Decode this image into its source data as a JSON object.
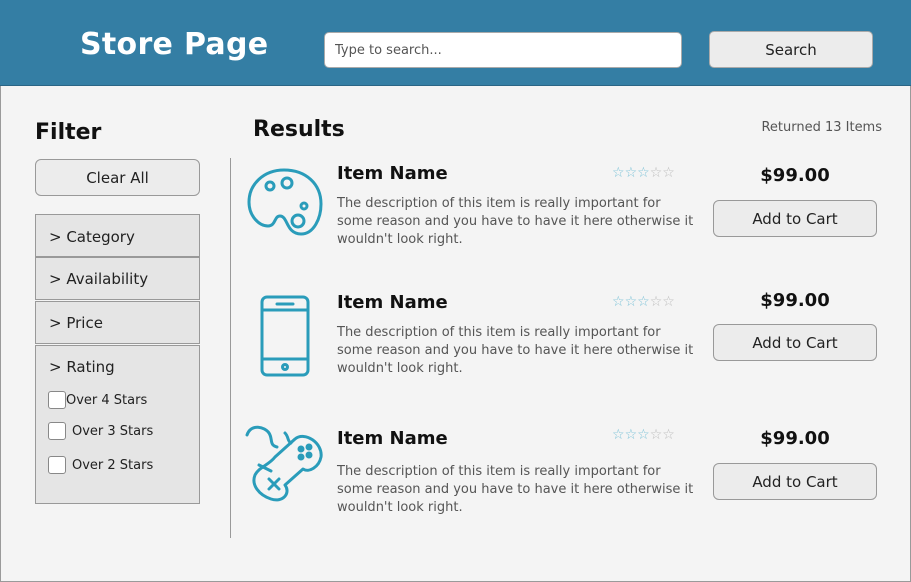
{
  "header": {
    "title": "Store Page",
    "search_placeholder": "Type to search...",
    "search_label": "Search"
  },
  "filter": {
    "title": "Filter",
    "clear_label": "Clear All",
    "sections": {
      "category": "> Category",
      "availability": "> Availability",
      "price": "> Price",
      "rating": "> Rating"
    },
    "rating_options": [
      "Over 4 Stars",
      "Over 3 Stars",
      "Over 2 Stars"
    ]
  },
  "results": {
    "title": "Results",
    "count_text": "Returned 13 Items",
    "items": [
      {
        "icon": "palette-icon",
        "name": "Item Name",
        "rating": 3,
        "description": "The description of this item is really important for some reason and you have to have it here otherwise it wouldn't look right.",
        "price": "$99.00",
        "button": "Add to Cart"
      },
      {
        "icon": "smartphone-icon",
        "name": "Item Name",
        "rating": 3,
        "description": "The description of this item is really important for some reason and you have to have it here otherwise it wouldn't look right.",
        "price": "$99.00",
        "button": "Add to Cart"
      },
      {
        "icon": "gamepad-icon",
        "name": "Item Name",
        "rating": 3,
        "description": "The description of this item is really important for some reason and you have to have it here otherwise it wouldn't look right.",
        "price": "$99.00",
        "button": "Add to Cart"
      }
    ]
  },
  "colors": {
    "header_bg": "#347ea4",
    "icon_color": "#2a9cba",
    "star_filled": "#7ec3d8",
    "star_empty": "#bdbdbd"
  }
}
